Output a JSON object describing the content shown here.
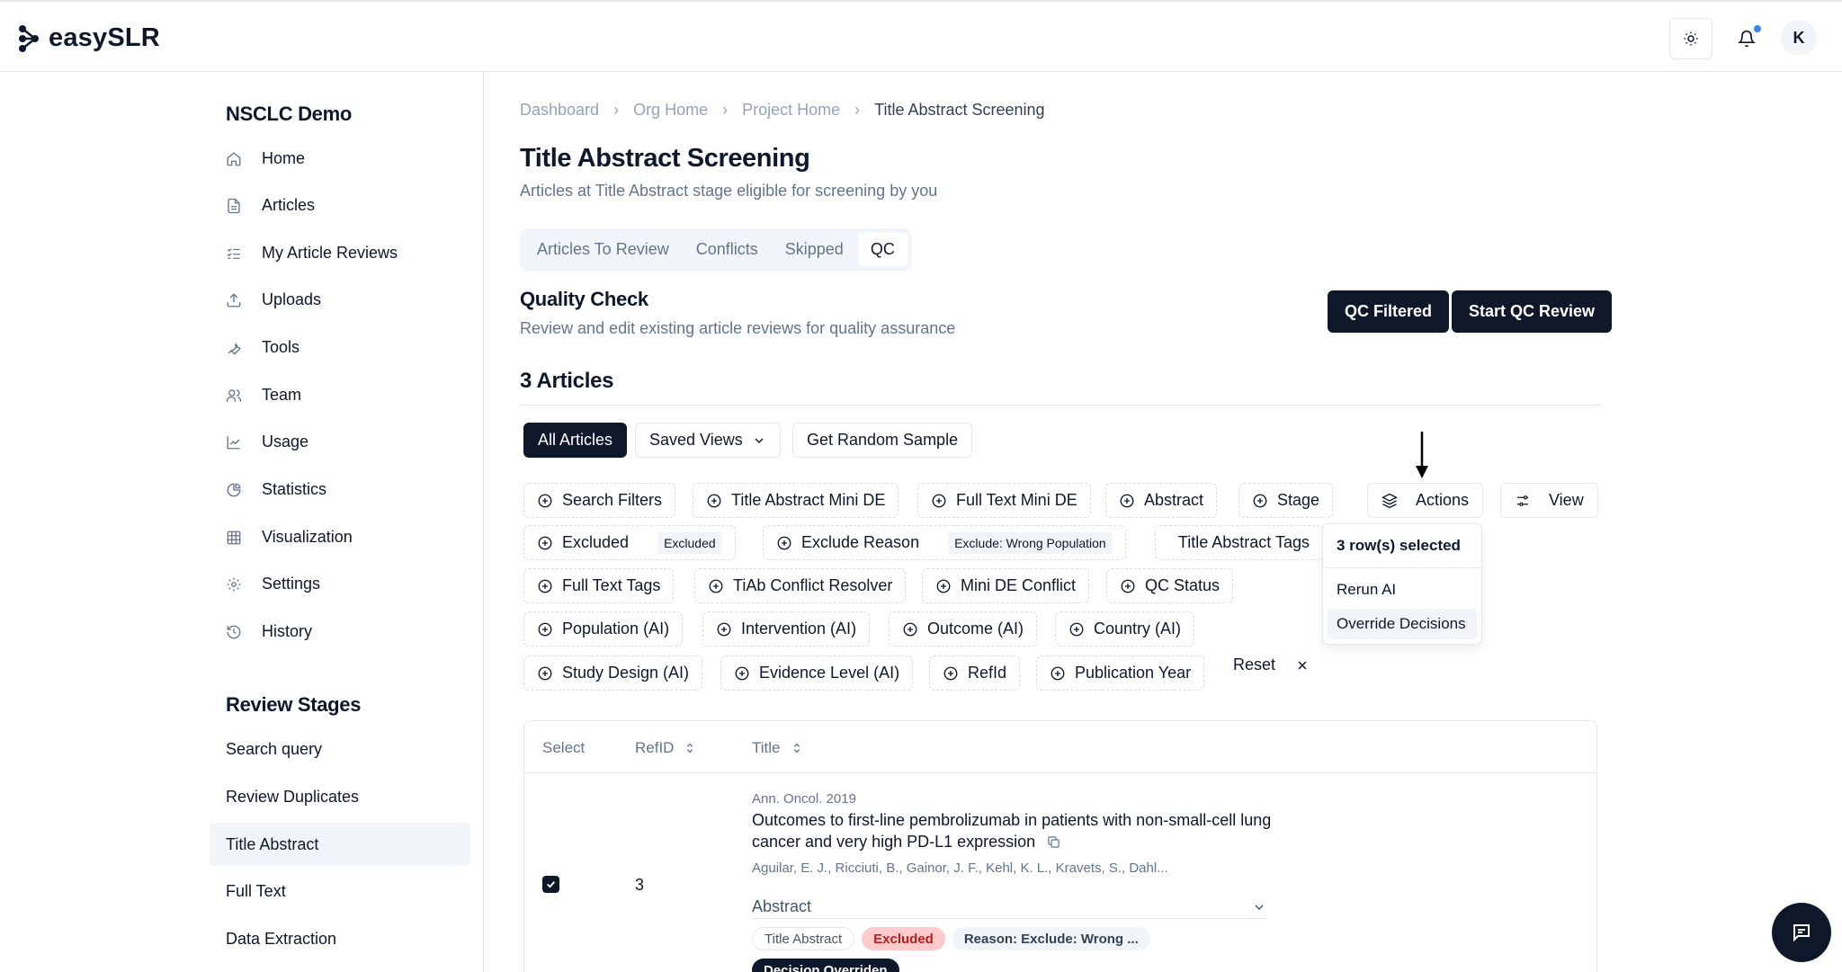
{
  "app": {
    "name": "easySLR",
    "user_initial": "K"
  },
  "sidebar": {
    "project": "NSCLC Demo",
    "items": [
      {
        "label": "Home",
        "icon": "home-icon"
      },
      {
        "label": "Articles",
        "icon": "file-icon"
      },
      {
        "label": "My Article Reviews",
        "icon": "checklist-icon"
      },
      {
        "label": "Uploads",
        "icon": "upload-icon"
      },
      {
        "label": "Tools",
        "icon": "wrench-icon"
      },
      {
        "label": "Team",
        "icon": "users-icon"
      },
      {
        "label": "Usage",
        "icon": "line-chart-icon"
      },
      {
        "label": "Statistics",
        "icon": "pie-chart-icon"
      },
      {
        "label": "Visualization",
        "icon": "grid-icon"
      },
      {
        "label": "Settings",
        "icon": "gear-icon"
      },
      {
        "label": "History",
        "icon": "history-icon"
      }
    ],
    "stages_title": "Review Stages",
    "stages": [
      "Search query",
      "Review Duplicates",
      "Title Abstract",
      "Full Text",
      "Data Extraction"
    ],
    "active_stage": "Title Abstract"
  },
  "breadcrumb": [
    "Dashboard",
    "Org Home",
    "Project Home",
    "Title Abstract Screening"
  ],
  "page": {
    "title": "Title Abstract Screening",
    "subtitle": "Articles at Title Abstract stage eligible for screening by you"
  },
  "tabs": [
    "Articles To Review",
    "Conflicts",
    "Skipped",
    "QC"
  ],
  "active_tab": "QC",
  "qc": {
    "title": "Quality Check",
    "subtitle": "Review and edit existing article reviews for quality assurance",
    "qc_filtered": "QC Filtered",
    "start_qc": "Start QC Review"
  },
  "count_title": "3 Articles",
  "toolbar": {
    "all_articles": "All Articles",
    "saved_views": "Saved Views",
    "random_sample": "Get Random Sample",
    "actions": "Actions",
    "view": "View"
  },
  "filters": {
    "search_filters": "Search Filters",
    "tiab_mini_de": "Title Abstract Mini DE",
    "ft_mini_de": "Full Text Mini DE",
    "abstract": "Abstract",
    "stage": "Stage",
    "excluded": "Excluded",
    "excluded_tag": "Excluded",
    "exclude_reason": "Exclude Reason",
    "exclude_reason_tag": "Exclude: Wrong Population",
    "tiab_tags": "Title Abstract Tags",
    "ft_tags": "Full Text Tags",
    "tiab_conflict": "TiAb Conflict Resolver",
    "mini_de_conflict": "Mini DE Conflict",
    "qc_status": "QC Status",
    "population": "Population (AI)",
    "intervention": "Intervention (AI)",
    "outcome": "Outcome (AI)",
    "country": "Country (AI)",
    "study_design": "Study Design (AI)",
    "evidence_level": "Evidence Level (AI)",
    "refid": "RefId",
    "pub_year": "Publication Year",
    "reset": "Reset"
  },
  "dropdown": {
    "header": "3 row(s) selected",
    "items": [
      "Rerun AI",
      "Override Decisions"
    ]
  },
  "table": {
    "headers": [
      "Select",
      "RefID",
      "Title"
    ],
    "rows": [
      {
        "refid": "3",
        "journal": "Ann. Oncol. 2019",
        "title": "Outcomes to first-line pembrolizumab in patients with non-small-cell lung cancer and very high PD-L1 expression",
        "authors": "Aguilar, E. J., Ricciuti, B., Gainor, J. F., Kehl, K. L., Kravets, S., Dahl...",
        "abstract_label": "Abstract",
        "pills": [
          "Title Abstract",
          "Excluded",
          "Reason: Exclude: Wrong ..."
        ],
        "badge": "Decision Overriden"
      }
    ]
  },
  "colors": {
    "primary": "#0f172a",
    "muted": "#64748b",
    "border": "#e5e7eb",
    "excluded_bg": "#fecaca",
    "excluded_fg": "#b91c1c",
    "notif": "#3b82f6"
  }
}
